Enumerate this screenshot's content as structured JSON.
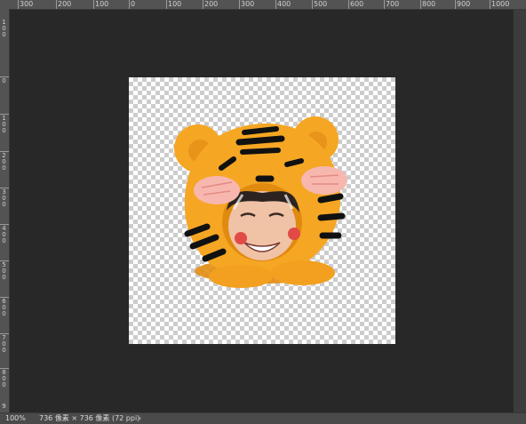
{
  "ruler": {
    "top_labels": [
      "300",
      "200",
      "100",
      "0",
      "100",
      "200",
      "300",
      "400",
      "500",
      "600",
      "700",
      "800",
      "900",
      "1000"
    ],
    "left_labels": [
      "1 0 0",
      "0",
      "1 0 0",
      "2 0 0",
      "3 0 0",
      "4 0 0",
      "5 0 0",
      "6 0 0",
      "7 0 0",
      "8 0 0",
      "9"
    ]
  },
  "document": {
    "artwork_name": "tiger hood sticker"
  },
  "status": {
    "zoom": "100%",
    "doc_info": "736 像素 × 736 像素 (72 ppi)",
    "arrow": "›"
  },
  "colors": {
    "workspace": "#282828",
    "ruler": "#535353",
    "tiger_orange": "#F5A623",
    "stripes": "#111111",
    "cheeks": "#F7B7AE"
  }
}
